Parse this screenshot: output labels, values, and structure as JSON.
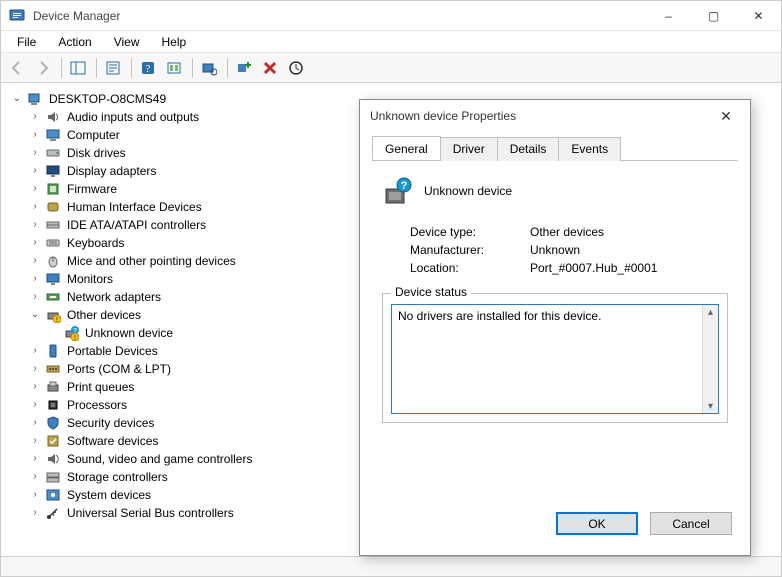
{
  "window": {
    "title": "Device Manager",
    "buttons": {
      "min": "–",
      "max": "▢",
      "close": "✕"
    }
  },
  "menu": [
    "File",
    "Action",
    "View",
    "Help"
  ],
  "toolbar_icons": [
    "back-icon",
    "forward-icon",
    "sep",
    "show-hide-tree-icon",
    "sep",
    "properties-icon",
    "sep",
    "help-icon",
    "event-viewer-icon",
    "sep",
    "scan-hardware-icon",
    "sep",
    "add-legacy-icon",
    "uninstall-icon",
    "update-driver-icon"
  ],
  "tree": {
    "root": {
      "label": "DESKTOP-O8CMS49",
      "expanded": true
    },
    "categories": [
      {
        "label": "Audio inputs and outputs",
        "icon": "speaker"
      },
      {
        "label": "Computer",
        "icon": "computer"
      },
      {
        "label": "Disk drives",
        "icon": "disk"
      },
      {
        "label": "Display adapters",
        "icon": "display"
      },
      {
        "label": "Firmware",
        "icon": "firmware"
      },
      {
        "label": "Human Interface Devices",
        "icon": "hid"
      },
      {
        "label": "IDE ATA/ATAPI controllers",
        "icon": "ide"
      },
      {
        "label": "Keyboards",
        "icon": "keyboard"
      },
      {
        "label": "Mice and other pointing devices",
        "icon": "mouse"
      },
      {
        "label": "Monitors",
        "icon": "monitor"
      },
      {
        "label": "Network adapters",
        "icon": "network"
      },
      {
        "label": "Other devices",
        "icon": "other",
        "expanded": true,
        "children": [
          {
            "label": "Unknown device",
            "icon": "unknown"
          }
        ]
      },
      {
        "label": "Portable Devices",
        "icon": "portable"
      },
      {
        "label": "Ports (COM & LPT)",
        "icon": "ports"
      },
      {
        "label": "Print queues",
        "icon": "printer"
      },
      {
        "label": "Processors",
        "icon": "cpu"
      },
      {
        "label": "Security devices",
        "icon": "security"
      },
      {
        "label": "Software devices",
        "icon": "software"
      },
      {
        "label": "Sound, video and game controllers",
        "icon": "sound"
      },
      {
        "label": "Storage controllers",
        "icon": "storage"
      },
      {
        "label": "System devices",
        "icon": "system"
      },
      {
        "label": "Universal Serial Bus controllers",
        "icon": "usb"
      }
    ]
  },
  "dialog": {
    "title": "Unknown device Properties",
    "tabs": [
      "General",
      "Driver",
      "Details",
      "Events"
    ],
    "active_tab": "General",
    "device_name": "Unknown device",
    "rows": {
      "type_label": "Device type:",
      "type_value": "Other devices",
      "mfr_label": "Manufacturer:",
      "mfr_value": "Unknown",
      "loc_label": "Location:",
      "loc_value": "Port_#0007.Hub_#0001"
    },
    "status_legend": "Device status",
    "status_text": "No drivers are installed for this device.",
    "ok": "OK",
    "cancel": "Cancel"
  }
}
